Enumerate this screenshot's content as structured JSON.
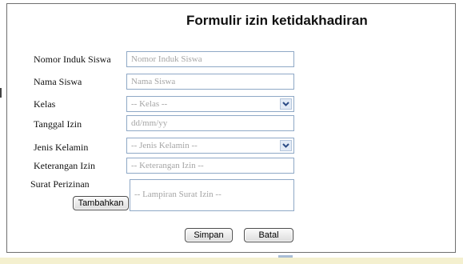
{
  "form": {
    "title": "Formulir izin ketidakhadiran",
    "labels": {
      "nis": "Nomor Induk Siswa",
      "nama": "Nama Siswa",
      "kelas": "Kelas",
      "tanggal": "Tanggal Izin",
      "jenis_kelamin": "Jenis Kelamin",
      "keterangan": "Keterangan Izin",
      "surat": "Surat Perizinan"
    },
    "placeholders": {
      "nis": "Nomor Induk Siswa",
      "nama": "Nama Siswa",
      "tanggal": "dd/mm/yy",
      "keterangan": "-- Keterangan Izin --",
      "lampiran": "-- Lampiran Surat Izin --"
    },
    "selects": {
      "kelas": "-- Kelas --",
      "jenis_kelamin": "-- Jenis Kelamin --"
    },
    "buttons": {
      "tambahkan": "Tambahkan",
      "simpan": "Simpan",
      "batal": "Batal"
    }
  },
  "icons": {
    "select_arrow": "chevron-down-icon"
  },
  "colors": {
    "field_border": "#8fa8c6",
    "placeholder_text": "#a5a5a5",
    "select_button": "#e3ebf6",
    "bottom_strip": "#f4f0cf"
  }
}
